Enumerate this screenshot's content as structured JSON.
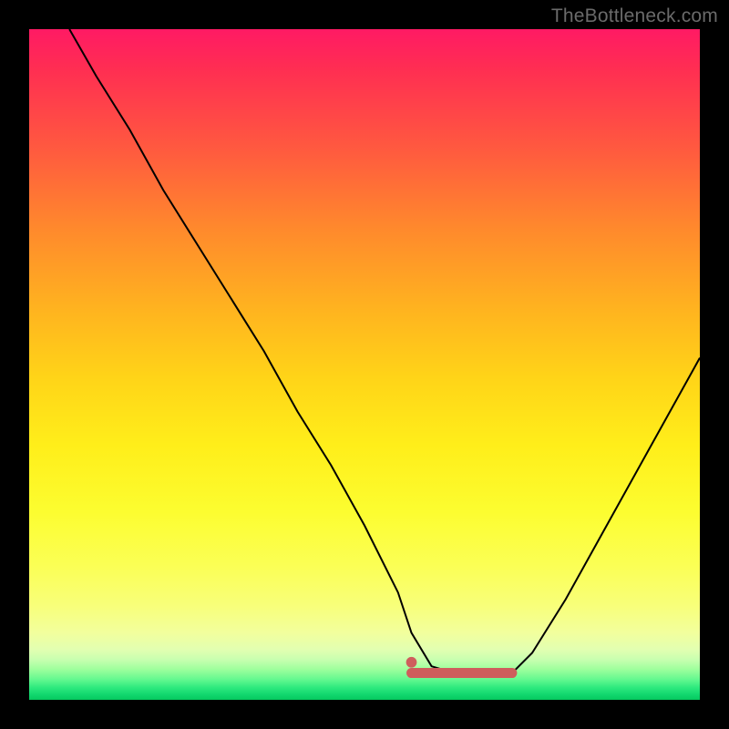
{
  "watermark": {
    "text": "TheBottleneck.com"
  },
  "chart_data": {
    "type": "line",
    "title": "",
    "xlabel": "",
    "ylabel": "",
    "xlim": [
      0,
      100
    ],
    "ylim": [
      0,
      100
    ],
    "grid": false,
    "legend": false,
    "series": [
      {
        "name": "bottleneck-curve",
        "x": [
          6,
          10,
          15,
          20,
          25,
          30,
          35,
          40,
          45,
          50,
          55,
          57,
          60,
          65,
          70,
          72,
          75,
          80,
          85,
          90,
          95,
          100
        ],
        "y": [
          100,
          93,
          85,
          76,
          68,
          60,
          52,
          43,
          35,
          26,
          16,
          10,
          5,
          3.5,
          3.5,
          4,
          7,
          15,
          24,
          33,
          42,
          51
        ],
        "color": "#000000",
        "stroke_width": 2
      },
      {
        "name": "optimal-flat-band",
        "x": [
          57,
          72
        ],
        "y": [
          4,
          4
        ],
        "color": "#cf5d5c",
        "stroke_width": 11,
        "note": "flat optimal region along valley bottom; left endpoint rendered with a small dot"
      }
    ],
    "background": {
      "type": "vertical-gradient",
      "stops": [
        {
          "pos": 0.0,
          "color": "#ff1a64"
        },
        {
          "pos": 0.3,
          "color": "#ff8a2c"
        },
        {
          "pos": 0.62,
          "color": "#ffee1a"
        },
        {
          "pos": 0.9,
          "color": "#f2ff9d"
        },
        {
          "pos": 1.0,
          "color": "#06c95f"
        }
      ]
    }
  }
}
